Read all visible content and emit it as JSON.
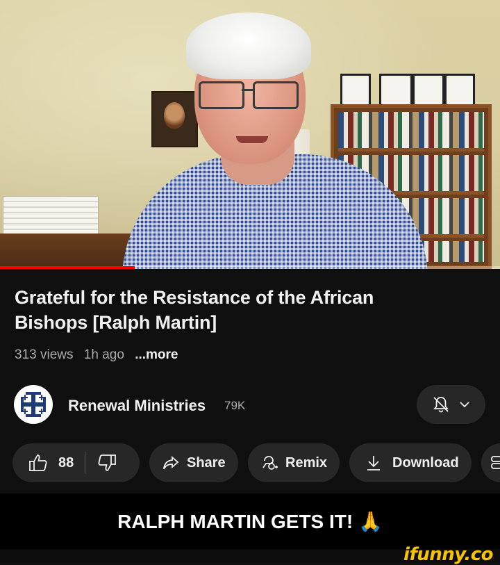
{
  "video": {
    "progress_fraction": 0.27,
    "progress_color": "#ff0000"
  },
  "title_line1": "Grateful for the Resistance of the African",
  "title_line2": "Bishops [Ralph Martin]",
  "meta": {
    "views": "313 views",
    "age": "1h ago",
    "more": "...more"
  },
  "channel": {
    "avatar_icon": "jerusalem-cross-icon",
    "name": "Renewal Ministries",
    "subscribers": "79K",
    "bell_icon": "notifications-off-bell-icon",
    "dropdown_icon": "chevron-down-icon"
  },
  "actions": {
    "like_icon": "thumb-up-icon",
    "like_count": "88",
    "dislike_icon": "thumb-down-icon",
    "share_icon": "share-arrow-icon",
    "share_label": "Share",
    "remix_icon": "remix-icon",
    "remix_label": "Remix",
    "download_icon": "download-icon",
    "download_label": "Download",
    "more_icon": "save-icon"
  },
  "caption": "RALPH MARTIN GETS IT! 🙏",
  "watermark": "ifunny.co",
  "colors": {
    "background": "#0f0f0f",
    "pill": "#272727",
    "secondary_text": "#aaaaaa",
    "watermark": "#f7c400"
  }
}
